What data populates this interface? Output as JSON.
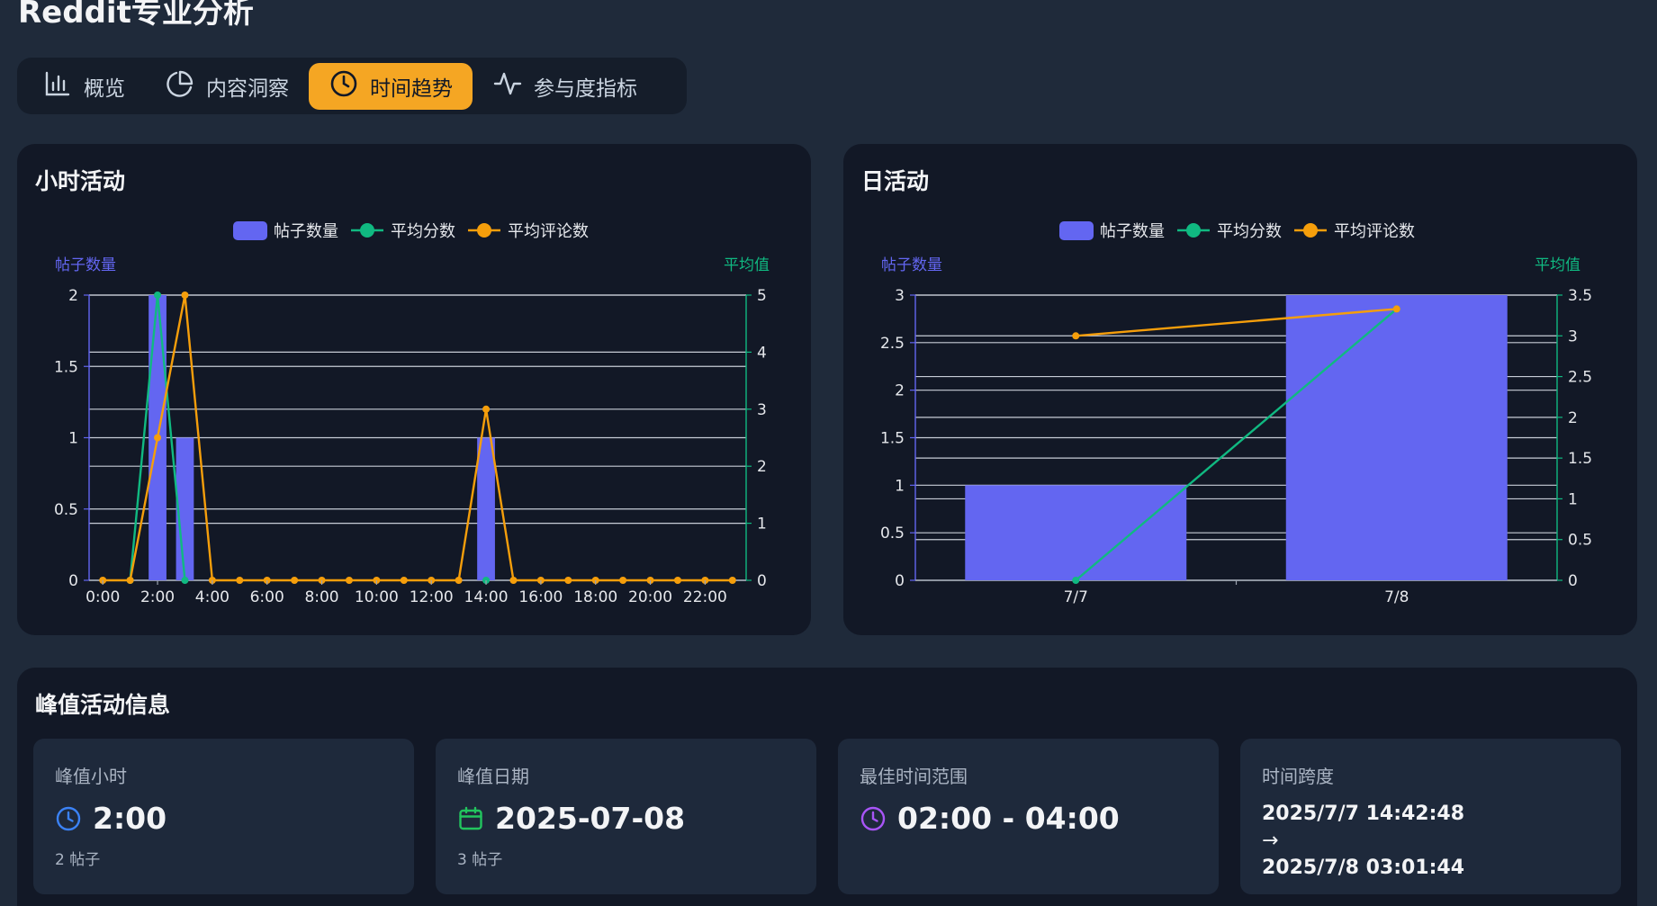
{
  "app": {
    "title": "Reddit专业分析"
  },
  "tabs": [
    {
      "label": "概览",
      "icon": "bar-chart-icon",
      "active": false
    },
    {
      "label": "内容洞察",
      "icon": "pie-chart-icon",
      "active": false
    },
    {
      "label": "时间趋势",
      "icon": "clock-icon",
      "active": true
    },
    {
      "label": "参与度指标",
      "icon": "activity-icon",
      "active": false
    }
  ],
  "colors": {
    "posts": "#6366f1",
    "avg_score": "#10b981",
    "avg_comments": "#f59e0b",
    "accent": "#f5a623"
  },
  "hourly": {
    "title": "小时活动"
  },
  "daily": {
    "title": "日活动"
  },
  "chart_data": [
    {
      "type": "bar",
      "title": "小时活动",
      "legend": [
        "帖子数量",
        "平均分数",
        "平均评论数"
      ],
      "ylabel_left": "帖子数量",
      "ylabel_right": "平均值",
      "ylim_left": [
        0,
        2
      ],
      "ylim_right": [
        0,
        5
      ],
      "left_ticks": [
        "0",
        "0.5",
        "1",
        "1.5",
        "2"
      ],
      "right_ticks": [
        "0",
        "1",
        "2",
        "3",
        "4",
        "5"
      ],
      "x_tick_labels": [
        "0:00",
        "2:00",
        "4:00",
        "6:00",
        "8:00",
        "10:00",
        "12:00",
        "14:00",
        "16:00",
        "18:00",
        "20:00",
        "22:00"
      ],
      "categories": [
        "0:00",
        "1:00",
        "2:00",
        "3:00",
        "4:00",
        "5:00",
        "6:00",
        "7:00",
        "8:00",
        "9:00",
        "10:00",
        "11:00",
        "12:00",
        "13:00",
        "14:00",
        "15:00",
        "16:00",
        "17:00",
        "18:00",
        "19:00",
        "20:00",
        "21:00",
        "22:00",
        "23:00"
      ],
      "series": [
        {
          "name": "帖子数量",
          "kind": "bar",
          "axis": "left",
          "values": [
            0,
            0,
            2,
            1,
            0,
            0,
            0,
            0,
            0,
            0,
            0,
            0,
            0,
            0,
            1,
            0,
            0,
            0,
            0,
            0,
            0,
            0,
            0,
            0
          ]
        },
        {
          "name": "平均分数",
          "kind": "line",
          "axis": "right",
          "values": [
            null,
            0,
            5,
            0,
            null,
            null,
            null,
            null,
            null,
            null,
            null,
            null,
            null,
            null,
            0,
            null,
            null,
            null,
            null,
            null,
            null,
            null,
            null,
            null
          ]
        },
        {
          "name": "平均评论数",
          "kind": "line",
          "axis": "right",
          "values": [
            0,
            0,
            2.5,
            5,
            0,
            0,
            0,
            0,
            0,
            0,
            0,
            0,
            0,
            0,
            3,
            0,
            0,
            0,
            0,
            0,
            0,
            0,
            0,
            0
          ]
        }
      ]
    },
    {
      "type": "bar",
      "title": "日活动",
      "legend": [
        "帖子数量",
        "平均分数",
        "平均评论数"
      ],
      "ylabel_left": "帖子数量",
      "ylabel_right": "平均值",
      "ylim_left": [
        0,
        3
      ],
      "ylim_right": [
        0,
        3.5
      ],
      "left_ticks": [
        "0",
        "0.5",
        "1",
        "1.5",
        "2",
        "2.5",
        "3"
      ],
      "right_ticks": [
        "0",
        "0.5",
        "1",
        "1.5",
        "2",
        "2.5",
        "3",
        "3.5"
      ],
      "categories": [
        "7/7",
        "7/8"
      ],
      "series": [
        {
          "name": "帖子数量",
          "kind": "bar",
          "axis": "left",
          "values": [
            1,
            3
          ]
        },
        {
          "name": "平均分数",
          "kind": "line",
          "axis": "right",
          "values": [
            0,
            3.33
          ]
        },
        {
          "name": "平均评论数",
          "kind": "line",
          "axis": "right",
          "values": [
            3,
            3.33
          ]
        }
      ]
    }
  ],
  "peak": {
    "title": "峰值活动信息",
    "cards": [
      {
        "label": "峰值小时",
        "icon": "clock-icon",
        "value": "2:00",
        "sub": "2 帖子"
      },
      {
        "label": "峰值日期",
        "icon": "calendar-icon",
        "value": "2025-07-08",
        "sub": "3 帖子"
      },
      {
        "label": "最佳时间范围",
        "icon": "clock-icon",
        "value": "02:00 - 04:00"
      },
      {
        "label": "时间跨度",
        "start": "2025/7/7 14:42:48",
        "arrow": "→",
        "end": "2025/7/8 03:01:44"
      }
    ]
  }
}
